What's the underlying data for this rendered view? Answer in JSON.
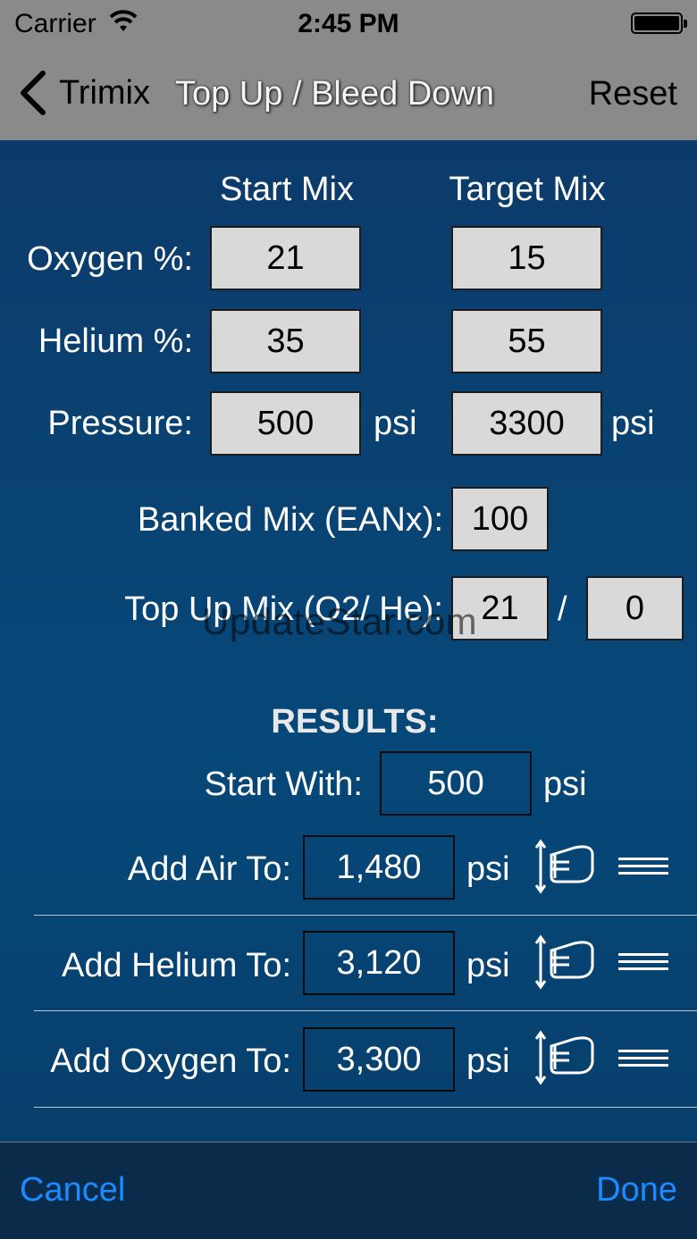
{
  "status_bar": {
    "carrier": "Carrier",
    "time": "2:45 PM"
  },
  "nav": {
    "back_label": "Trimix",
    "title": "Top Up / Bleed Down",
    "reset_label": "Reset"
  },
  "columns": {
    "start": "Start Mix",
    "target": "Target Mix"
  },
  "rows": {
    "oxygen": {
      "label": "Oxygen %:",
      "start": "21",
      "target": "15"
    },
    "helium": {
      "label": "Helium %:",
      "start": "35",
      "target": "55"
    },
    "pressure": {
      "label": "Pressure:",
      "start": "500",
      "target": "3300",
      "unit": "psi"
    }
  },
  "banked": {
    "label": "Banked Mix (EANx):",
    "value": "100"
  },
  "topup": {
    "label": "Top Up Mix (O2/ He):",
    "o2": "21",
    "slash": "/",
    "he": "0"
  },
  "results": {
    "heading": "RESULTS:",
    "start_with": {
      "label": "Start With:",
      "value": "500",
      "unit": "psi"
    },
    "items": [
      {
        "label": "Add Air To:",
        "value": "1,480",
        "unit": "psi"
      },
      {
        "label": "Add Helium To:",
        "value": "3,120",
        "unit": "psi"
      },
      {
        "label": "Add Oxygen To:",
        "value": "3,300",
        "unit": "psi"
      }
    ]
  },
  "watermark": "UpdateStar.com",
  "toolbar": {
    "cancel": "Cancel",
    "done": "Done"
  },
  "icons": {
    "tank": "tank-fill-icon",
    "reorder": "reorder-handle-icon",
    "back": "chevron-left-icon",
    "wifi": "wifi-icon",
    "battery": "battery-icon"
  },
  "colors": {
    "background": "#0b3d6d",
    "bar": "#8a8a8a",
    "accent": "#1a8cff",
    "field": "#d9d9d9"
  }
}
